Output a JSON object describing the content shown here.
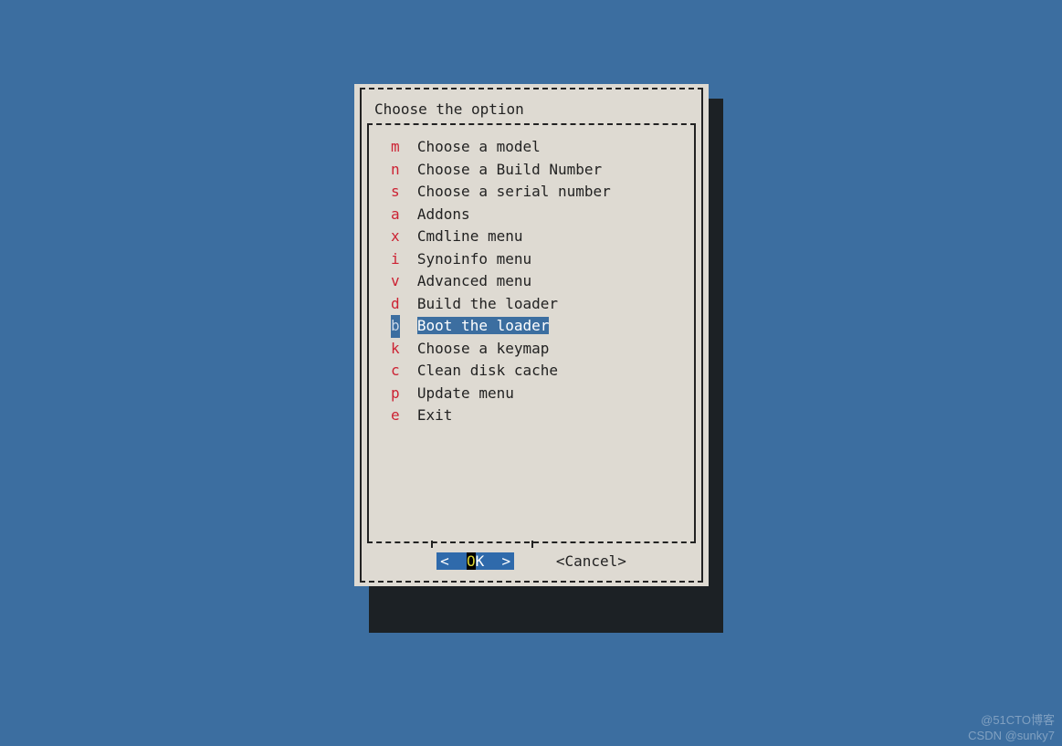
{
  "dialog": {
    "title": "Choose the option",
    "items": [
      {
        "key": "m",
        "label": "Choose a model"
      },
      {
        "key": "n",
        "label": "Choose a Build Number"
      },
      {
        "key": "s",
        "label": "Choose a serial number"
      },
      {
        "key": "a",
        "label": "Addons"
      },
      {
        "key": "x",
        "label": "Cmdline menu"
      },
      {
        "key": "i",
        "label": "Synoinfo menu"
      },
      {
        "key": "v",
        "label": "Advanced menu"
      },
      {
        "key": "d",
        "label": "Build the loader"
      },
      {
        "key": "b",
        "label": "Boot the loader",
        "selected": true
      },
      {
        "key": "k",
        "label": "Choose a keymap"
      },
      {
        "key": "c",
        "label": "Clean disk cache"
      },
      {
        "key": "p",
        "label": "Update menu"
      },
      {
        "key": "e",
        "label": "Exit"
      }
    ],
    "buttons": {
      "ok": {
        "left": "<  ",
        "hot": "O",
        "rest": "K  >"
      },
      "cancel": "<Cancel>"
    }
  },
  "watermark": {
    "line1": "@51CTO博客",
    "line2": "CSDN @sunky7"
  }
}
